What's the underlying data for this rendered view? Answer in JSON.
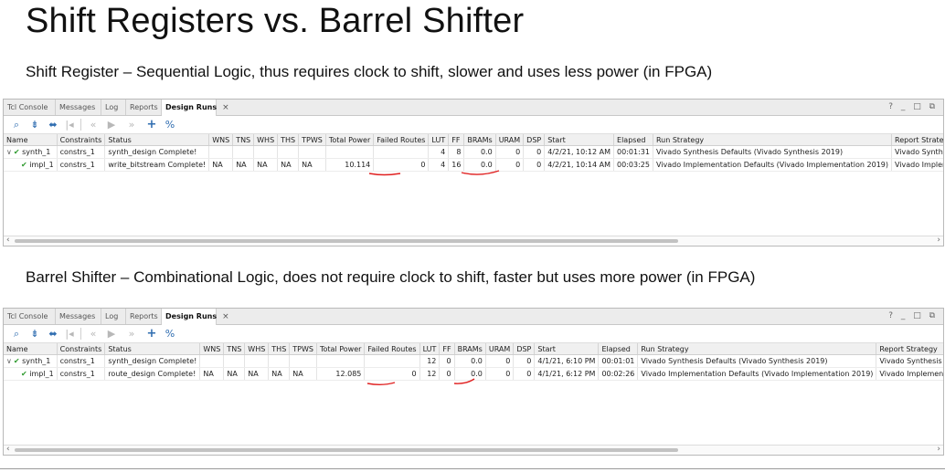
{
  "slide": {
    "title": "Shift Registers vs. Barrel Shifter",
    "caption_top": "Shift Register – Sequential Logic, thus requires clock to shift, slower and uses less power (in FPGA)",
    "caption_bottom": "Barrel Shifter – Combinational Logic, does not require clock to shift, faster but uses more power (in FPGA)"
  },
  "tabs": [
    "Tcl Console",
    "Messages",
    "Log",
    "Reports",
    "Design Runs"
  ],
  "active_tab": "Design Runs",
  "tab_close": "×",
  "window_controls": "? _ □ ⧉",
  "toolbar_icons": [
    "search-icon",
    "collapse-all-icon",
    "expand-all-icon",
    "first-icon",
    "previous-icon",
    "run-icon",
    "last-icon",
    "add-icon",
    "percent-icon"
  ],
  "columns": [
    "Name",
    "Constraints",
    "Status",
    "WNS",
    "TNS",
    "WHS",
    "THS",
    "TPWS",
    "Total Power",
    "Failed Routes",
    "LUT",
    "FF",
    "BRAMs",
    "URAM",
    "DSP",
    "Start",
    "Elapsed",
    "Run Strategy",
    "Report Strategy"
  ],
  "panel1": {
    "synth": {
      "name": "synth_1",
      "constraints": "constrs_1",
      "status": "synth_design Complete!",
      "wns": "",
      "tns": "",
      "whs": "",
      "ths": "",
      "tpws": "",
      "power": "",
      "failed": "",
      "lut": "4",
      "ff": "8",
      "brams": "0.0",
      "uram": "0",
      "dsp": "0",
      "start": "4/2/21, 10:12 AM",
      "elapsed": "00:01:31",
      "strategy": "Vivado Synthesis Defaults (Vivado Synthesis 2019)",
      "report": "Vivado Synthesis D"
    },
    "impl": {
      "name": "impl_1",
      "constraints": "constrs_1",
      "status": "write_bitstream Complete!",
      "wns": "NA",
      "tns": "NA",
      "whs": "NA",
      "ths": "NA",
      "tpws": "NA",
      "power": "10.114",
      "failed": "0",
      "lut": "4",
      "ff": "16",
      "brams": "0.0",
      "uram": "0",
      "dsp": "0",
      "start": "4/2/21, 10:14 AM",
      "elapsed": "00:03:25",
      "strategy": "Vivado Implementation Defaults (Vivado Implementation 2019)",
      "report": "Vivado Implement"
    }
  },
  "panel2": {
    "synth": {
      "name": "synth_1",
      "constraints": "constrs_1",
      "status": "synth_design Complete!",
      "wns": "",
      "tns": "",
      "whs": "",
      "ths": "",
      "tpws": "",
      "power": "",
      "failed": "",
      "lut": "12",
      "ff": "0",
      "brams": "0.0",
      "uram": "0",
      "dsp": "0",
      "start": "4/1/21, 6:10 PM",
      "elapsed": "00:01:01",
      "strategy": "Vivado Synthesis Defaults (Vivado Synthesis 2019)",
      "report": "Vivado Synthesis D"
    },
    "impl": {
      "name": "impl_1",
      "constraints": "constrs_1",
      "status": "route_design Complete!",
      "wns": "NA",
      "tns": "NA",
      "whs": "NA",
      "ths": "NA",
      "tpws": "NA",
      "power": "12.085",
      "failed": "0",
      "lut": "12",
      "ff": "0",
      "brams": "0.0",
      "uram": "0",
      "dsp": "0",
      "start": "4/1/21, 6:12 PM",
      "elapsed": "00:02:26",
      "strategy": "Vivado Implementation Defaults (Vivado Implementation 2019)",
      "report": "Vivado Implementa"
    }
  },
  "colors": {
    "check": "#2e9a2e",
    "annotation": "#e02020",
    "toolbar_icon": "#2f6db0"
  }
}
